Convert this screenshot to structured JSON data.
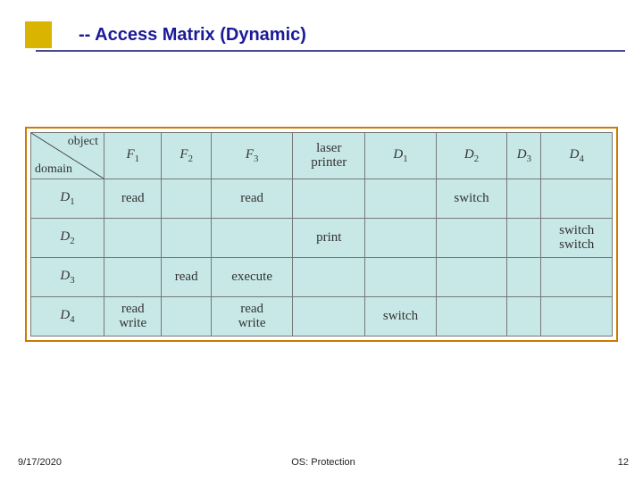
{
  "slide": {
    "title": "-- Access Matrix (Dynamic)"
  },
  "matrix": {
    "corner": {
      "object": "object",
      "domain": "domain"
    },
    "objects": [
      {
        "base": "F",
        "sub": "1"
      },
      {
        "base": "F",
        "sub": "2"
      },
      {
        "base": "F",
        "sub": "3"
      },
      {
        "text": "laser printer"
      },
      {
        "base": "D",
        "sub": "1"
      },
      {
        "base": "D",
        "sub": "2"
      },
      {
        "base": "D",
        "sub": "3"
      },
      {
        "base": "D",
        "sub": "4"
      }
    ],
    "domains": [
      {
        "base": "D",
        "sub": "1"
      },
      {
        "base": "D",
        "sub": "2"
      },
      {
        "base": "D",
        "sub": "3"
      },
      {
        "base": "D",
        "sub": "4"
      }
    ],
    "cells": [
      [
        "read",
        "",
        "read",
        "",
        "",
        "switch",
        "",
        ""
      ],
      [
        "",
        "",
        "",
        "print",
        "",
        "",
        "",
        "switch switch"
      ],
      [
        "",
        "read",
        "execute",
        "",
        "",
        "",
        "",
        ""
      ],
      [
        "read write",
        "",
        "read write",
        "",
        "switch",
        "",
        "",
        ""
      ]
    ]
  },
  "footer": {
    "date": "9/17/2020",
    "center": "OS: Protection",
    "page": "12"
  },
  "colors": {
    "accent": "#d9b400",
    "title": "#1a1a99",
    "rule": "#4a4a8a",
    "table_border": "#cc7a00",
    "cell_bg": "#c8e8e8"
  }
}
